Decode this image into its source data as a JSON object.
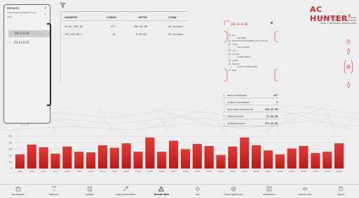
{
  "results": {
    "title": "RESULTS",
    "subtitle": "Total Hosts Evaluated: 2 (1)",
    "source": "zeek",
    "items": [
      {
        "label": "192.0.0.30",
        "selected": true
      },
      {
        "label": "23.11.0.35",
        "selected": false
      }
    ],
    "pager": "1 / 1"
  },
  "connections": {
    "columns": [
      "ADDRESS",
      "CONNS",
      "BYTES",
      "CONN"
    ],
    "rows": [
      [
        "10.55.250.10",
        "477",
        "390.48 KB",
        "G3 uniques"
      ],
      [
        "192.168.88.2",
        "10",
        "0.58 KB",
        "G3 uniques"
      ]
    ]
  },
  "host": {
    "ip": "192.0.0.30",
    "lines": [
      "asn",
      "AS15169",
      "Verified Global Registry Services LLC",
      "range",
      "192.0.0.0/24",
      "org",
      "country",
      "United States",
      "portal",
      "monitor",
      "(UTC-5) GLOBAL REG",
      "tags"
    ]
  },
  "stats": [
    {
      "label": "total connections",
      "value": "487"
    },
    {
      "label": "unique connections",
      "value": "6"
    },
    {
      "label": "total bytes transferred",
      "value": "390.98 KB"
    },
    {
      "label": "inbound bytes",
      "value": "37.98 KB"
    },
    {
      "label": "outbound bytes",
      "value": "353.00 KB"
    }
  ],
  "brand": {
    "logo": "AC HUNTER",
    "reg": "®",
    "info": [
      "- DATABASE WEEKLY (AS OF 3/21/24)",
      "- WEEKLY THREAT RPTS",
      "- TIME: 1 NETWORK CONNECTIONS"
    ]
  },
  "chart_data": {
    "type": "bar",
    "categories": [
      "12/4",
      "12/5",
      "12/6",
      "12/7",
      "12/8",
      "12/9",
      "12/10",
      "12/11",
      "12/12",
      "12/13",
      "12/14",
      "12/15",
      "12/16",
      "12/17",
      "12/18",
      "12/19",
      "12/20",
      "12/21",
      "12/22",
      "12/23",
      "12/24",
      "12/25",
      "12/26",
      "12/27",
      "12/28",
      "12/29",
      "12/30",
      "12/31"
    ],
    "values": [
      22,
      37,
      33,
      23,
      34,
      26,
      25,
      36,
      32,
      39,
      26,
      48,
      26,
      43,
      30,
      38,
      35,
      21,
      34,
      48,
      36,
      28,
      22,
      31,
      35,
      24,
      26,
      39
    ],
    "yticks": [
      "0",
      "10",
      "20",
      "30",
      "40",
      "50"
    ],
    "ylim": [
      0,
      50
    ],
    "grid": true,
    "colors": {
      "bar_top": "#e53935",
      "bar_bottom": "#b71c1c"
    }
  },
  "nav": [
    {
      "label": "dashboard",
      "icon": "dashboard-icon",
      "active": false
    },
    {
      "label": "beacons",
      "icon": "beacon-icon",
      "active": false
    },
    {
      "label": "profiles",
      "icon": "profile-icon",
      "active": false
    },
    {
      "label": "long connections",
      "icon": "long-connections-icon",
      "active": false
    },
    {
      "label": "threat intel",
      "icon": "threat-warning-icon",
      "active": true
    },
    {
      "label": "dns",
      "icon": "dns-icon",
      "active": false
    },
    {
      "label": "client signatures",
      "icon": "signature-icon",
      "active": false
    },
    {
      "label": "certificates",
      "icon": "certificate-icon",
      "active": false
    },
    {
      "label": "beacon dns",
      "icon": "beacon-dns-icon",
      "active": false
    },
    {
      "label": "logout",
      "icon": "logout-icon",
      "active": false
    }
  ],
  "colors": {
    "accent": "#d32f2f",
    "panel_border": "#1b2d33"
  }
}
